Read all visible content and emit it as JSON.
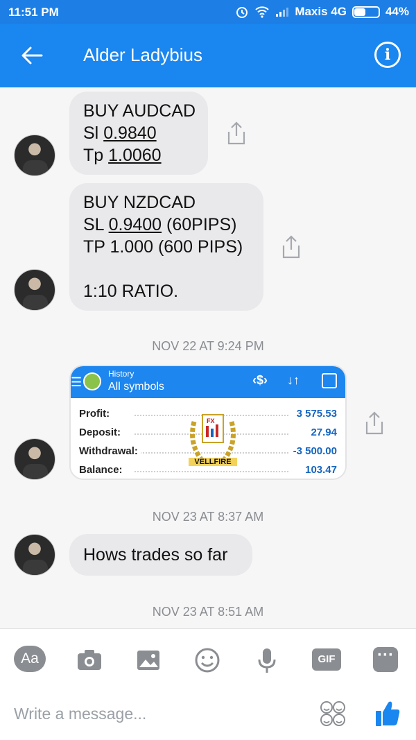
{
  "status_bar": {
    "time": "11:51 PM",
    "carrier": "Maxis 4G",
    "battery": "44%"
  },
  "header": {
    "title": "Alder Ladybius"
  },
  "messages": [
    {
      "lines": [
        {
          "prefix": "BUY AUDCAD",
          "underlined": "",
          "suffix": ""
        },
        {
          "prefix": "Sl ",
          "underlined": "0.9840",
          "suffix": ""
        },
        {
          "prefix": "Tp ",
          "underlined": "1.0060",
          "suffix": ""
        }
      ]
    },
    {
      "lines": [
        {
          "prefix": "BUY NZDCAD",
          "underlined": "",
          "suffix": ""
        },
        {
          "prefix": "SL ",
          "underlined": "0.9400",
          "suffix": " (60PIPS)"
        },
        {
          "prefix": "TP 1.000 (600 PIPS)",
          "underlined": "",
          "suffix": ""
        },
        {
          "prefix": "",
          "underlined": "",
          "suffix": ""
        },
        {
          "prefix": "1:10 RATIO.",
          "underlined": "",
          "suffix": ""
        }
      ]
    },
    {
      "lines": [
        {
          "prefix": "Hows trades so far",
          "underlined": "",
          "suffix": ""
        }
      ]
    }
  ],
  "timestamps": [
    "NOV 22 AT 9:24 PM",
    "NOV 23 AT 8:37 AM",
    "NOV 23 AT 8:51 AM"
  ],
  "card": {
    "header_small": "History",
    "header_main": "All symbols",
    "emblem_text": "VELLFIRE",
    "rows": [
      {
        "label": "Profit:",
        "value": "3 575.53"
      },
      {
        "label": "Deposit:",
        "value": "27.94"
      },
      {
        "label": "Withdrawal:",
        "value": "-3 500.00"
      },
      {
        "label": "Balance:",
        "value": "103.47"
      }
    ],
    "accent": "#1d86ef",
    "value_color": "#1565c0"
  },
  "composer": {
    "aa_label": "Aa",
    "gif_label": "GIF",
    "more_label": "···",
    "placeholder": "Write a message...",
    "value": ""
  },
  "icons": {
    "back": "arrow-left",
    "info": "info-circle",
    "share": "share-upload",
    "camera": "camera",
    "image": "image",
    "emoji": "smiley",
    "mic": "microphone",
    "like": "thumbs-up"
  },
  "colors": {
    "brand": "#1a86ef",
    "bubble": "#e9e9eb",
    "muted": "#8a8d91"
  }
}
